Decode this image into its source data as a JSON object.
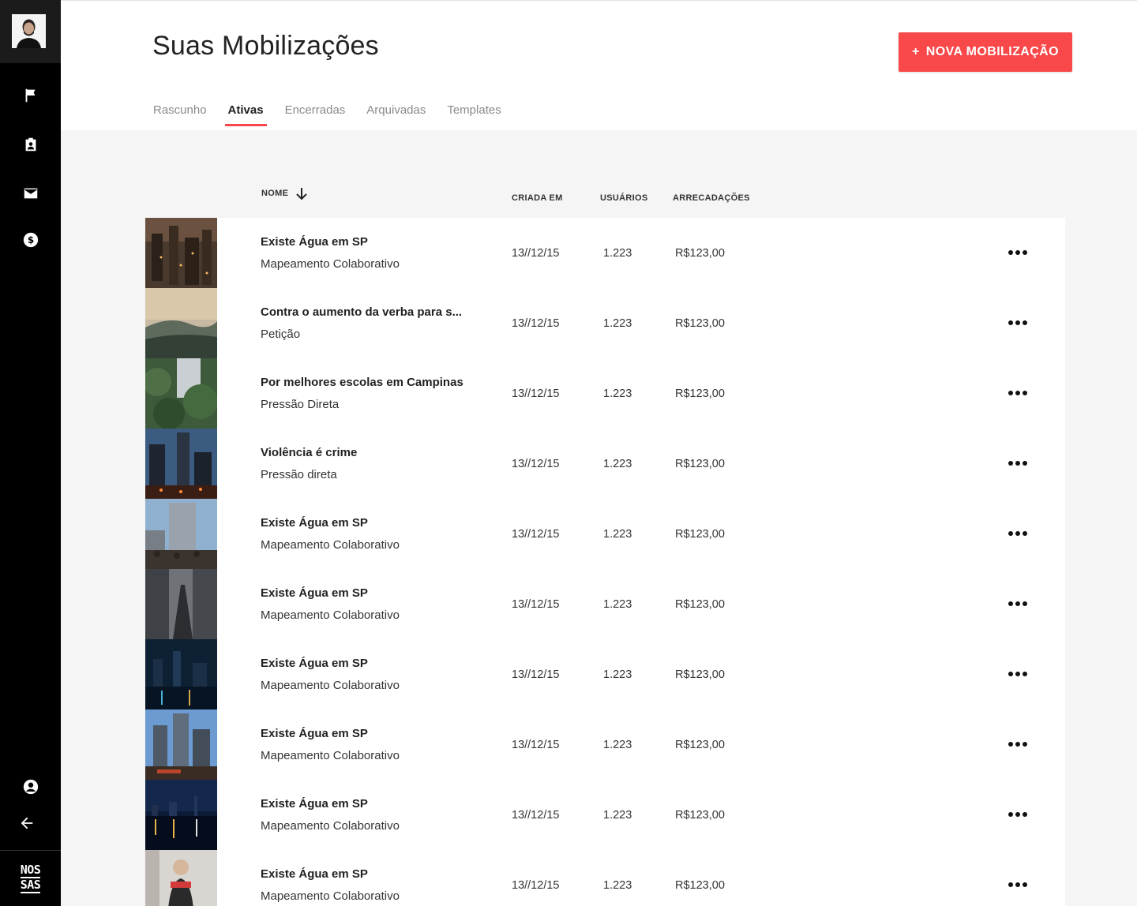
{
  "sidebar": {
    "nav": [
      {
        "icon": "flag-icon"
      },
      {
        "icon": "clipboard-user-icon"
      },
      {
        "icon": "mail-icon"
      },
      {
        "icon": "dollar-icon"
      }
    ],
    "bottom": [
      {
        "icon": "account-icon"
      },
      {
        "icon": "arrow-left-icon"
      }
    ],
    "brand_line1": "NOS",
    "brand_line2": "SAS"
  },
  "header": {
    "title": "Suas Mobilizações",
    "new_button_plus": "+",
    "new_button_label": "NOVA MOBILIZAÇÃO",
    "accent_color": "#f9484a"
  },
  "tabs": [
    {
      "label": "Rascunho",
      "active": false
    },
    {
      "label": "Ativas",
      "active": true
    },
    {
      "label": "Encerradas",
      "active": false
    },
    {
      "label": "Arquivadas",
      "active": false
    },
    {
      "label": "Templates",
      "active": false
    }
  ],
  "table": {
    "columns": {
      "name": "NOME",
      "created": "CRIADA EM",
      "users": "USUÁRIOS",
      "funds": "ARRECADAÇÕES"
    },
    "rows": [
      {
        "name": "Existe Água em SP",
        "type": "Mapeamento Colaborativo",
        "created": "13//12/15",
        "users": "1.223",
        "funds": "R$123,00",
        "thumb": "city-night-aerial"
      },
      {
        "name": "Contra o aumento da verba para s...",
        "type": "Petição",
        "created": "13//12/15",
        "users": "1.223",
        "funds": "R$123,00",
        "thumb": "mountain-sunset"
      },
      {
        "name": "Por melhores escolas em Campinas",
        "type": "Pressão Direta",
        "created": "13//12/15",
        "users": "1.223",
        "funds": "R$123,00",
        "thumb": "trees-building"
      },
      {
        "name": "Violência é crime",
        "type": "Pressão direta",
        "created": "13//12/15",
        "users": "1.223",
        "funds": "R$123,00",
        "thumb": "city-street-dusk"
      },
      {
        "name": "Existe Água em SP",
        "type": "Mapeamento Colaborativo",
        "created": "13//12/15",
        "users": "1.223",
        "funds": "R$123,00",
        "thumb": "crowd-skyscraper"
      },
      {
        "name": "Existe Água em SP",
        "type": "Mapeamento Colaborativo",
        "created": "13//12/15",
        "users": "1.223",
        "funds": "R$123,00",
        "thumb": "rail-city"
      },
      {
        "name": "Existe Água em SP",
        "type": "Mapeamento Colaborativo",
        "created": "13//12/15",
        "users": "1.223",
        "funds": "R$123,00",
        "thumb": "river-night"
      },
      {
        "name": "Existe Água em SP",
        "type": "Mapeamento Colaborativo",
        "created": "13//12/15",
        "users": "1.223",
        "funds": "R$123,00",
        "thumb": "towers-blue-sky"
      },
      {
        "name": "Existe Água em SP",
        "type": "Mapeamento Colaborativo",
        "created": "13//12/15",
        "users": "1.223",
        "funds": "R$123,00",
        "thumb": "skyline-water-night"
      },
      {
        "name": "Existe Água em SP",
        "type": "Mapeamento Colaborativo",
        "created": "13//12/15",
        "users": "1.223",
        "funds": "R$123,00",
        "thumb": "person-street"
      }
    ]
  }
}
